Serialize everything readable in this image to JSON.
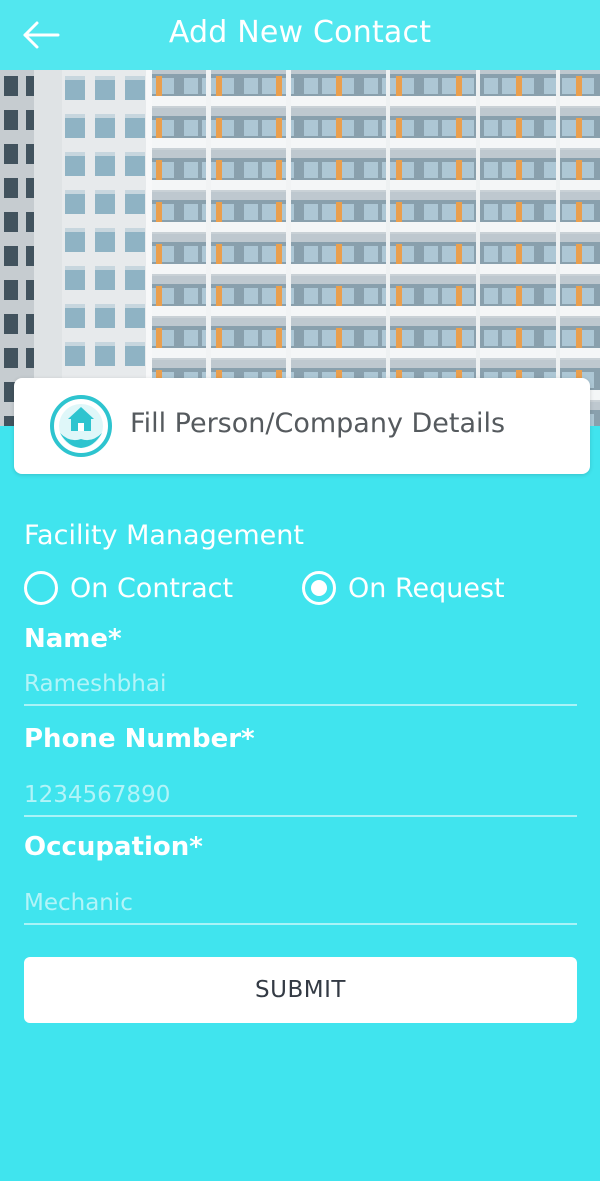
{
  "header": {
    "title": "Add New Contact",
    "back_icon": "arrow-left-icon"
  },
  "hero": {
    "image": "apartment-building-photo"
  },
  "details_card": {
    "icon": "house-in-hand-icon",
    "title": "Fill Person/Company Details"
  },
  "facility": {
    "label": "Facility Management",
    "options": [
      {
        "label": "On Contract",
        "selected": false
      },
      {
        "label": "On Request",
        "selected": true
      }
    ]
  },
  "fields": {
    "name": {
      "label": "Name*",
      "placeholder": "Rameshbhai"
    },
    "phone": {
      "label": "Phone Number*",
      "placeholder": "1234567890"
    },
    "occupation": {
      "label": "Occupation*",
      "placeholder": "Mechanic"
    }
  },
  "submit_label": "SUBMIT",
  "colors": {
    "background": "#40E4EE",
    "header": "#52E7EF",
    "icon_accent": "#2EC4CF"
  }
}
